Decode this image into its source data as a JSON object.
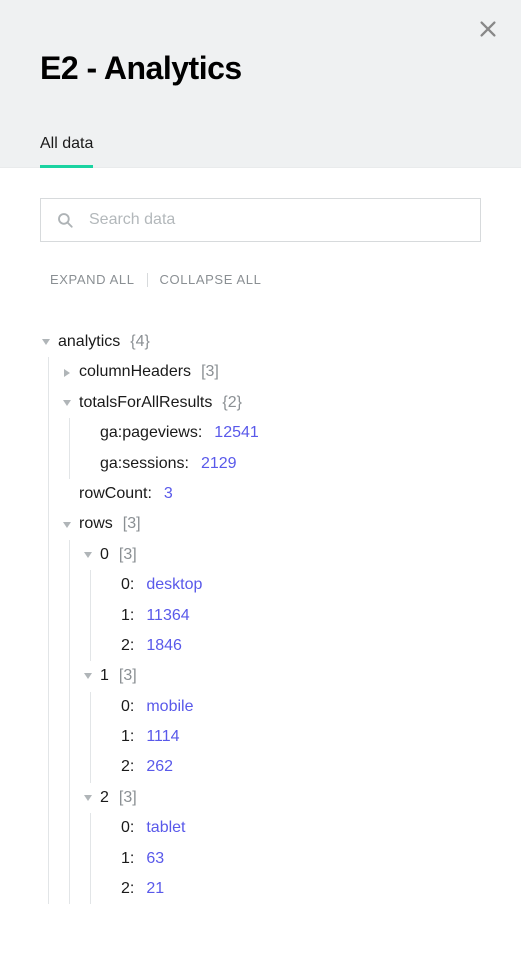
{
  "header": {
    "title": "E2 - Analytics",
    "tabs": [
      {
        "label": "All data",
        "active": true
      }
    ]
  },
  "search": {
    "placeholder": "Search data"
  },
  "actions": {
    "expand": "EXPAND ALL",
    "collapse": "COLLAPSE ALL"
  },
  "tree": {
    "root": {
      "key": "analytics",
      "meta": "{4}",
      "expanded": true,
      "children": [
        {
          "key": "columnHeaders",
          "meta": "[3]",
          "expanded": false
        },
        {
          "key": "totalsForAllResults",
          "meta": "{2}",
          "expanded": true,
          "children": [
            {
              "key": "ga:pageviews:",
              "value": "12541"
            },
            {
              "key": "ga:sessions:",
              "value": "2129"
            }
          ]
        },
        {
          "key": "rowCount:",
          "value": "3"
        },
        {
          "key": "rows",
          "meta": "[3]",
          "expanded": true,
          "children": [
            {
              "key": "0",
              "meta": "[3]",
              "expanded": true,
              "children": [
                {
                  "key": "0:",
                  "value": "desktop"
                },
                {
                  "key": "1:",
                  "value": "11364"
                },
                {
                  "key": "2:",
                  "value": "1846"
                }
              ]
            },
            {
              "key": "1",
              "meta": "[3]",
              "expanded": true,
              "children": [
                {
                  "key": "0:",
                  "value": "mobile"
                },
                {
                  "key": "1:",
                  "value": "1114"
                },
                {
                  "key": "2:",
                  "value": "262"
                }
              ]
            },
            {
              "key": "2",
              "meta": "[3]",
              "expanded": true,
              "children": [
                {
                  "key": "0:",
                  "value": "tablet"
                },
                {
                  "key": "1:",
                  "value": "63"
                },
                {
                  "key": "2:",
                  "value": "21"
                }
              ]
            }
          ]
        }
      ]
    }
  }
}
